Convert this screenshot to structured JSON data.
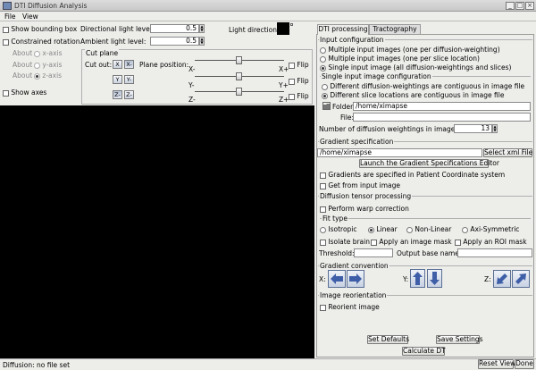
{
  "window": {
    "title": "DTI Diffusion Analysis"
  },
  "menu": [
    "File",
    "View"
  ],
  "left": {
    "show_bounding_box": "Show bounding box",
    "constrained_rotation": "Constrained rotation",
    "about_label": "About",
    "about_x": "x-axis",
    "about_y": "y-axis",
    "about_z": "z-axis",
    "show_axes": "Show axes",
    "directional_light_label": "Directional light level:",
    "directional_light_value": "0.5",
    "ambient_light_label": "Ambient light level:",
    "ambient_light_value": "0.5",
    "light_direction_label": "Light direction:",
    "cut_plane": {
      "title": "Cut plane",
      "cut_out_label": "Cut out:",
      "plane_position_label": "Plane position:",
      "x_buttons": [
        "X",
        "X-"
      ],
      "y_buttons": [
        "Y",
        "Y-"
      ],
      "z_buttons": [
        "Z-",
        "Z-"
      ],
      "x_min": "X-",
      "x_max": "X+",
      "y_min": "Y-",
      "y_max": "Y+",
      "z_min": "Z-",
      "z_max": "Z+",
      "flip": "Flip"
    }
  },
  "tabs": [
    "DTI processing",
    "Tractography"
  ],
  "input_config": {
    "title": "Input configuration",
    "opt_multiple_diffusion": "Multiple input images (one per diffusion-weighting)",
    "opt_multiple_slice": "Multiple input images (one per slice location)",
    "opt_single": "Single input image (all diffusion-weightings and slices)",
    "single_config_title": "Single input image configuration",
    "opt_different_diffusion": "Different diffusion-weightings are contiguous in image file",
    "opt_different_slice": "Different slice locations are contiguous in image file",
    "folder_label": "Folder:",
    "folder_value": "/home/ximapse",
    "file_label": "File:",
    "file_value": "",
    "num_weightings_label": "Number of diffusion  weightings in image:",
    "num_weightings_value": "13"
  },
  "gradient_spec": {
    "title": "Gradient specification",
    "path_value": "/home/ximapse",
    "select_button": "Select xml File",
    "launch_button": "Launch the Gradient Specifications Editor",
    "patient_coord": "Gradients are specified in Patient Coordinate system",
    "get_from_input": "Get from input image"
  },
  "diffusion_processing": {
    "title": "Diffusion tensor processing",
    "warp_correction": "Perform warp correction",
    "fit_type_title": "Fit type",
    "fit_isotropic": "Isotropic",
    "fit_linear": "Linear",
    "fit_nonlinear": "Non-Linear",
    "fit_axisym": "Axi-Symmetric",
    "isolate_brain": "Isolate brain",
    "apply_mask": "Apply an image mask",
    "apply_roi": "Apply an ROI mask",
    "threshold_label": "Threshold:",
    "threshold_value": "",
    "output_base_label": "Output base name:",
    "output_base_value": ""
  },
  "gradient_convention": {
    "title": "Gradient convention",
    "x_label": "X:",
    "y_label": "Y:",
    "z_label": "Z:"
  },
  "image_reorientation": {
    "title": "Image reorientation",
    "reorient": "Reorient image"
  },
  "buttons": {
    "set_defaults": "Set Defaults",
    "save_settings": "Save Settings",
    "calculate": "Calculate DT",
    "reset_view": "Reset View",
    "done": "Done"
  },
  "status": {
    "text": "Diffusion: no file set"
  },
  "colors": {
    "canvas": "#000000",
    "arrow": "#3f5ea8"
  }
}
